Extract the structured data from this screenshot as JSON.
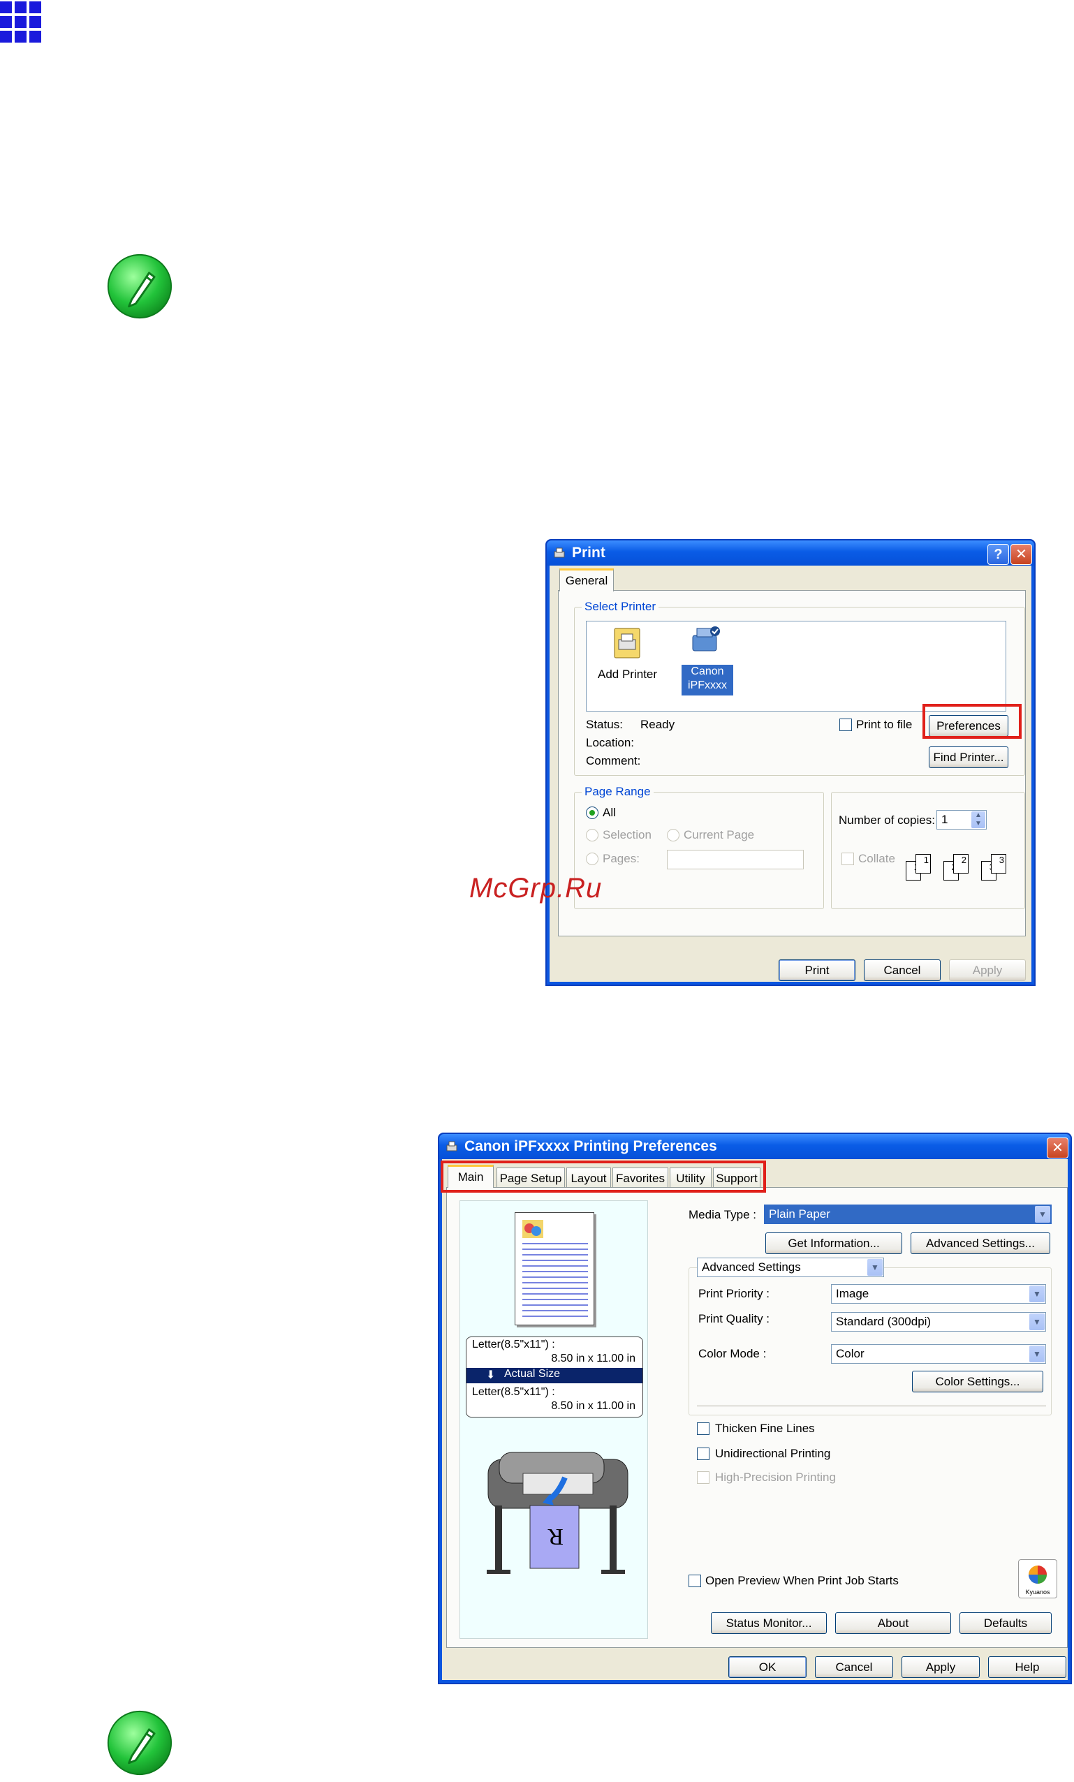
{
  "print_dialog": {
    "title": "Print",
    "help_btn": "?",
    "close_btn": "✕",
    "tab": "General",
    "select_printer": {
      "label": "Select Printer",
      "add_printer": "Add Printer",
      "canon_line1": "Canon",
      "canon_line2": "iPFxxxx"
    },
    "status_label": "Status:",
    "status_value": "Ready",
    "location_label": "Location:",
    "comment_label": "Comment:",
    "print_to_file": "Print to file",
    "preferences": "Preferences",
    "find_printer": "Find Printer...",
    "page_range": {
      "label": "Page Range",
      "all": "All",
      "selection": "Selection",
      "current_page": "Current Page",
      "pages": "Pages:"
    },
    "number_of_copies_label": "Number of copies:",
    "copies_value": "1",
    "collate": "Collate",
    "collate_pages": [
      "1",
      "1",
      "2",
      "2",
      "3",
      "3"
    ],
    "buttons": {
      "print": "Print",
      "cancel": "Cancel",
      "apply": "Apply"
    }
  },
  "prefs_dialog": {
    "title": "Canon iPFxxxx Printing Preferences",
    "close_btn": "✕",
    "tabs": [
      "Main",
      "Page Setup",
      "Layout",
      "Favorites",
      "Utility",
      "Support"
    ],
    "paper_info": {
      "line1": "Letter(8.5\"x11\") :",
      "line2": "8.50 in x 11.00 in",
      "highlight": "Actual Size",
      "line3": "Letter(8.5\"x11\") :",
      "line4": "8.50 in x 11.00 in"
    },
    "media_type_label": "Media Type :",
    "media_type_value": "Plain Paper",
    "get_information": "Get Information...",
    "advanced_settings_btn": "Advanced Settings...",
    "mode_value": "Advanced Settings",
    "print_priority_label": "Print Priority :",
    "print_priority_value": "Image",
    "print_quality_label": "Print Quality :",
    "print_quality_value": "Standard (300dpi)",
    "color_mode_label": "Color Mode :",
    "color_mode_value": "Color",
    "color_settings": "Color Settings...",
    "thicken_fine_lines": "Thicken Fine Lines",
    "unidirectional_printing": "Unidirectional Printing",
    "high_precision_printing": "High-Precision Printing",
    "open_preview": "Open Preview When Print Job Starts",
    "kyuanos": "Kyuanos",
    "status_monitor": "Status Monitor...",
    "about": "About",
    "defaults": "Defaults",
    "buttons": {
      "ok": "OK",
      "cancel": "Cancel",
      "apply": "Apply",
      "help": "Help"
    }
  },
  "watermark": "McGrp.Ru",
  "colors": {
    "xp_blue": "#0b56e0",
    "highlight": "#e0201a",
    "note_green": "#22c33a"
  }
}
